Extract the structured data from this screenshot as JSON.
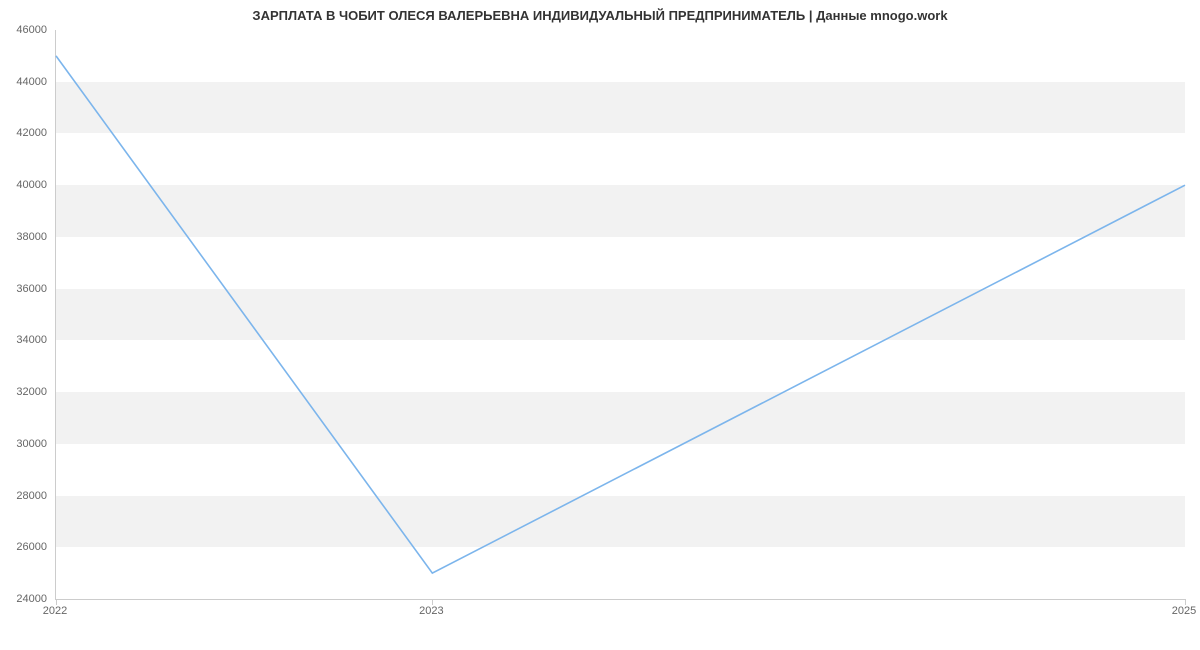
{
  "chart_data": {
    "type": "line",
    "title": "ЗАРПЛАТА В ЧОБИТ ОЛЕСЯ ВАЛЕРЬЕВНА ИНДИВИДУАЛЬНЫЙ ПРЕДПРИНИМАТЕЛЬ | Данные mnogo.work",
    "x": [
      2022,
      2023,
      2025
    ],
    "values": [
      45000,
      25000,
      40000
    ],
    "x_ticks": [
      2022,
      2023,
      2025
    ],
    "y_ticks": [
      24000,
      26000,
      28000,
      30000,
      32000,
      34000,
      36000,
      38000,
      40000,
      42000,
      44000,
      46000
    ],
    "xlim": [
      2022,
      2025
    ],
    "ylim": [
      24000,
      46000
    ],
    "line_color": "#7cb5ec"
  }
}
